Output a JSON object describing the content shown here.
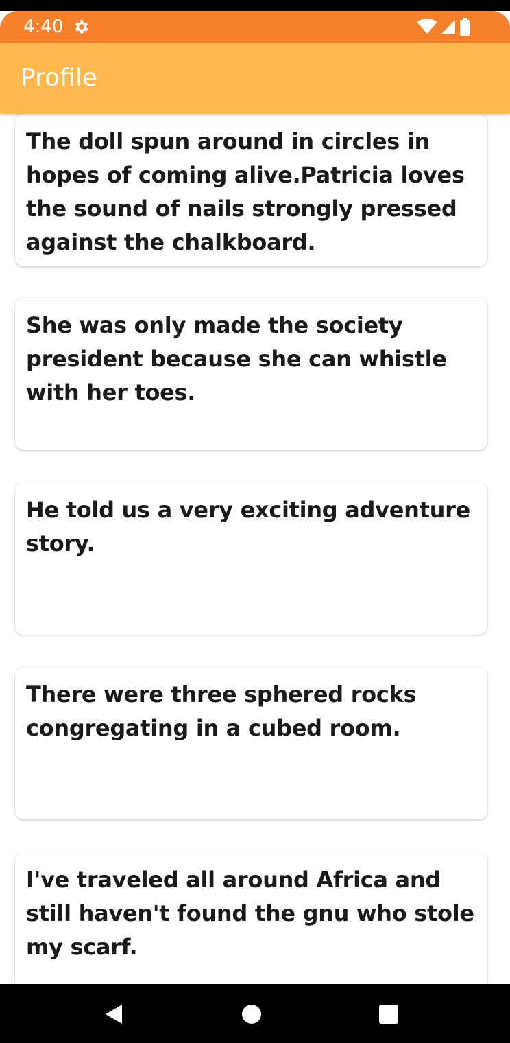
{
  "status_bar": {
    "time": "4:40",
    "icons": [
      "settings-icon",
      "wifi-icon",
      "signal-icon",
      "battery-icon"
    ],
    "color": "#f57f2a"
  },
  "app_bar": {
    "title": "Profile",
    "color": "#ffb84d"
  },
  "cards": [
    {
      "text": "The doll spun around in circles in hopes of coming alive.Patricia loves the sound of nails strongly pressed against the chalkboard."
    },
    {
      "text": "She was only made the society president because she can whistle with her toes."
    },
    {
      "text": "He told us a very exciting adventure story."
    },
    {
      "text": "There were three sphered rocks congregating in a cubed room."
    },
    {
      "text": "I've traveled all around Africa and still haven't found the gnu who stole my scarf."
    }
  ],
  "nav_bar": {
    "buttons": [
      "back-icon",
      "home-icon",
      "recents-icon"
    ]
  }
}
